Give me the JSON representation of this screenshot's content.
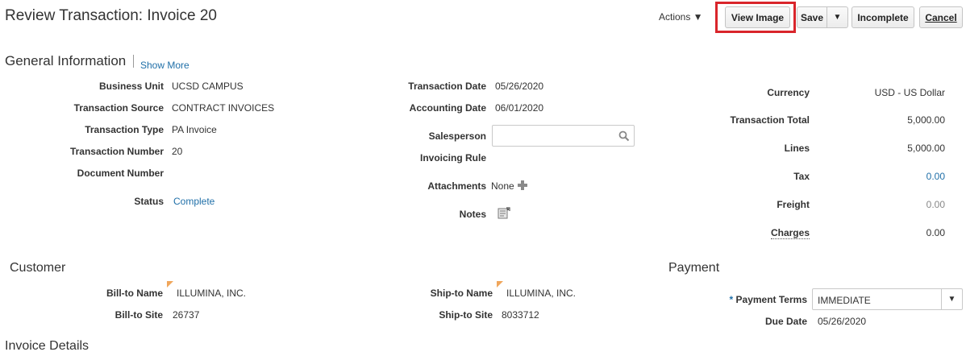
{
  "header": {
    "title": "Review Transaction: Invoice 20",
    "actions_label": "Actions ▼",
    "view_image_label": "View Image",
    "save_label": "Save",
    "save_menu_glyph": "▼",
    "incomplete_label": "Incomplete",
    "cancel_label": "Cancel"
  },
  "general": {
    "title": "General Information",
    "show_more": "Show More",
    "business_unit": {
      "label": "Business Unit",
      "value": "UCSD CAMPUS"
    },
    "transaction_source": {
      "label": "Transaction Source",
      "value": "CONTRACT INVOICES"
    },
    "transaction_type": {
      "label": "Transaction Type",
      "value": "PA Invoice"
    },
    "transaction_number": {
      "label": "Transaction Number",
      "value": "20"
    },
    "document_number": {
      "label": "Document Number",
      "value": ""
    },
    "status": {
      "label": "Status",
      "value": "Complete"
    },
    "transaction_date": {
      "label": "Transaction Date",
      "value": "05/26/2020"
    },
    "accounting_date": {
      "label": "Accounting Date",
      "value": "06/01/2020"
    },
    "salesperson": {
      "label": "Salesperson",
      "value": ""
    },
    "invoicing_rule": {
      "label": "Invoicing Rule",
      "value": ""
    },
    "attachments": {
      "label": "Attachments",
      "value": "None"
    },
    "notes": {
      "label": "Notes"
    }
  },
  "totals": {
    "currency": {
      "label": "Currency",
      "value": "USD - US Dollar"
    },
    "transaction_total": {
      "label": "Transaction Total",
      "value": "5,000.00"
    },
    "lines": {
      "label": "Lines",
      "value": "5,000.00"
    },
    "tax": {
      "label": "Tax",
      "value": "0.00"
    },
    "freight": {
      "label": "Freight",
      "value": "0.00"
    },
    "charges": {
      "label": "Charges",
      "value": "0.00"
    }
  },
  "customer": {
    "title": "Customer",
    "bill_to_name": {
      "label": "Bill-to Name",
      "value": "ILLUMINA, INC."
    },
    "bill_to_site": {
      "label": "Bill-to Site",
      "value": "26737"
    },
    "ship_to_name": {
      "label": "Ship-to Name",
      "value": "ILLUMINA, INC."
    },
    "ship_to_site": {
      "label": "Ship-to Site",
      "value": "8033712"
    }
  },
  "payment": {
    "title": "Payment",
    "required_marker": "*",
    "payment_terms": {
      "label": "Payment Terms",
      "value": "IMMEDIATE"
    },
    "due_date": {
      "label": "Due Date",
      "value": "05/26/2020"
    }
  },
  "invoice_details": {
    "title": "Invoice Details"
  },
  "colors": {
    "link": "#1f6fa8",
    "highlight": "#d9252b",
    "marker": "#f0a65b",
    "muted": "#888888"
  }
}
